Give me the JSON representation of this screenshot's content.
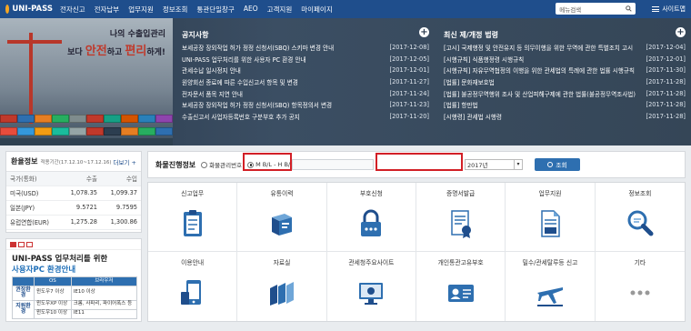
{
  "header": {
    "logo": "UNI-PASS",
    "nav": [
      "전자신고",
      "전자납부",
      "업무지원",
      "정보조회",
      "통관단일창구",
      "AEO",
      "고객지원",
      "마이페이지"
    ],
    "menu_search": "메뉴검색",
    "sitemap": "사이트맵"
  },
  "banner": {
    "line1": "나의 수출입관리",
    "line2_pre": "보다 ",
    "line2_a": "안전",
    "line2_mid": "하고 ",
    "line2_b": "편리",
    "line2_post": "하게!"
  },
  "notices": {
    "title": "공지사항",
    "items": [
      {
        "t": "보세공장 장외작업 허가 정정 신청서(SBQ) 스키마 변경 안내",
        "d": "[2017-12-08]"
      },
      {
        "t": "UNI-PASS 업무처리를 위한 사용자 PC 환경 안내",
        "d": "[2017-12-05]"
      },
      {
        "t": "관세수납 일시정지 안내",
        "d": "[2017-12-01]"
      },
      {
        "t": "원양회선 종료에 따른 수입신고서 항목 및 변경",
        "d": "[2017-11-27]"
      },
      {
        "t": "전자문서 품목 지연 안내",
        "d": "[2017-11-24]"
      },
      {
        "t": "보세공장 장외작업 허가 정정 신청서(SBQ) 항목정의서 변경",
        "d": "[2017-11-23]"
      },
      {
        "t": "수출신고서 사업자등록번호 구분부호 추가 공지",
        "d": "[2017-11-20]"
      }
    ]
  },
  "laws": {
    "title": "최신 제/개정 법령",
    "items": [
      {
        "t": "[고시] 국제행정 및 안전유지 등 의무이행을 위한 무역에 관한 특별조치 고시",
        "d": "[2017-12-04]"
      },
      {
        "t": "[시행규칙] 식품행정령 시행규칙",
        "d": "[2017-12-01]"
      },
      {
        "t": "[시행규칙] 자유무역협정의 이행을 위한 관세법의 특례에 관한 법률 시행규칙",
        "d": "[2017-11-30]"
      },
      {
        "t": "[법률] 문화재보호법",
        "d": "[2017-11-28]"
      },
      {
        "t": "[법률] 불공정무역행위 조사 및 산업피해구제에 관한 법률(불공정무역조사법)",
        "d": "[2017-11-28]"
      },
      {
        "t": "[법률] 항만법",
        "d": "[2017-11-28]"
      },
      {
        "t": "[시행령] 관세법 시행령",
        "d": "[2017-11-28]"
      }
    ]
  },
  "rates": {
    "title": "환율정보",
    "period": "적용기간(17.12.10~17.12.16)",
    "more": "더보기 +",
    "head": [
      "국가(통화)",
      "수출",
      "수입"
    ],
    "rows": [
      [
        "미국(USD)",
        "1,078.35",
        "1,099.37"
      ],
      [
        "일본(JPY)",
        "9.5721",
        "9.7595"
      ],
      [
        "유럽연합(EUR)",
        "1,275.28",
        "1,300.86"
      ]
    ]
  },
  "pc_env": {
    "title1": "UNI-PASS 업무처리를 위한",
    "title2": "사용자PC 환경안내",
    "head": [
      "OS",
      "브라우저"
    ],
    "group1": "권장환경",
    "group2": "지원환경",
    "rows": [
      [
        "윈도우7 이상",
        "IE10 이상"
      ],
      [
        "윈도우XP 이상",
        "크롬, 사파리, 파이어폭스 등"
      ],
      [
        "윈도우10 이상",
        "IE11"
      ]
    ]
  },
  "cargo": {
    "label": "화물진행정보",
    "radio1": "화물관리번호",
    "radio2": "M B/L - H B/L",
    "year": "2017년",
    "search": "조회"
  },
  "services": [
    {
      "label": "신고업무",
      "icon": "clipboard-icon"
    },
    {
      "label": "유통이력",
      "icon": "book-icon"
    },
    {
      "label": "부호신청",
      "icon": "lock-icon"
    },
    {
      "label": "증명서발급",
      "icon": "certificate-icon"
    },
    {
      "label": "업무지원",
      "icon": "document-icon"
    },
    {
      "label": "정보조회",
      "icon": "search-icon"
    },
    {
      "label": "이용안내",
      "icon": "phone-icon"
    },
    {
      "label": "자료실",
      "icon": "books-icon"
    },
    {
      "label": "관세청주요사이트",
      "icon": "monitor-icon"
    },
    {
      "label": "개인통관고유부호",
      "icon": "id-card-icon"
    },
    {
      "label": "밀수/관세탈루등 신고",
      "icon": "airplane-icon"
    },
    {
      "label": "기타",
      "icon": "more-icon"
    }
  ],
  "colors": {
    "primary": "#1f4e8c",
    "accent": "#2e6fb0",
    "highlight": "#d21f26"
  }
}
